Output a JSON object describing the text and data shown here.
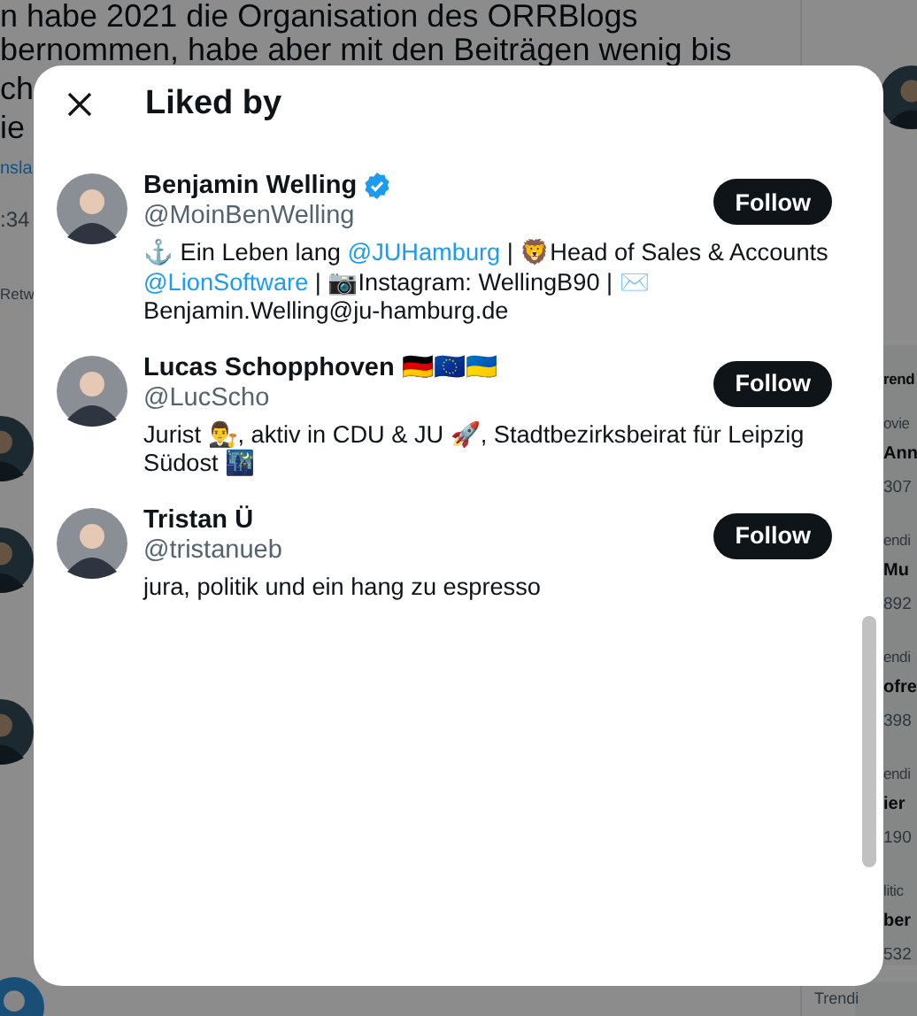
{
  "background": {
    "tweet_lines": [
      "n habe 2021 die Organisation des ORRBlogs",
      "bernommen, habe aber mit den Beiträgen wenig bis",
      "ch",
      "ie"
    ],
    "translate_link": "nsla",
    "time": ":34",
    "retweet_label": "Retw",
    "trends": {
      "title": "rend",
      "items": [
        {
          "context": "ovie",
          "name": "Ann",
          "count": "307"
        },
        {
          "context": "endi",
          "name": "Mu",
          "count": "892"
        },
        {
          "context": "endi",
          "name": "ofre",
          "count": "398"
        },
        {
          "context": "endi",
          "name": "ier",
          "count": "190"
        },
        {
          "context": "litic",
          "name": "ber",
          "count": "532"
        }
      ],
      "next_label": "Trendi"
    }
  },
  "dialog": {
    "title": "Liked by",
    "users": [
      {
        "name": "Benjamin Welling",
        "verified": true,
        "handle": "@MoinBenWelling",
        "button": "Follow",
        "bio": [
          {
            "kind": "text",
            "text": "⚓ Ein Leben lang "
          },
          {
            "kind": "link",
            "text": "@JUHamburg"
          },
          {
            "kind": "text",
            "text": " | 🦁Head of Sales & Accounts "
          },
          {
            "kind": "link",
            "text": "@LionSoftware"
          },
          {
            "kind": "text",
            "text": " | 📷Instagram: WellingB90 | ✉️Benjamin.Welling@ju-hamburg.de"
          }
        ]
      },
      {
        "name": "Lucas Schopphoven 🇩🇪🇪🇺🇺🇦",
        "verified": false,
        "handle": "@LucScho",
        "button": "Follow",
        "bio": [
          {
            "kind": "text",
            "text": "Jurist 👨‍⚖️, aktiv in CDU & JU 🚀, Stadtbezirksbeirat für Leipzig Südost 🌃"
          }
        ]
      },
      {
        "name": "Tristan Ü",
        "verified": false,
        "handle": "@tristanueb",
        "button": "Follow",
        "bio": [
          {
            "kind": "text",
            "text": "jura, politik und ein hang zu espresso"
          }
        ]
      }
    ]
  }
}
